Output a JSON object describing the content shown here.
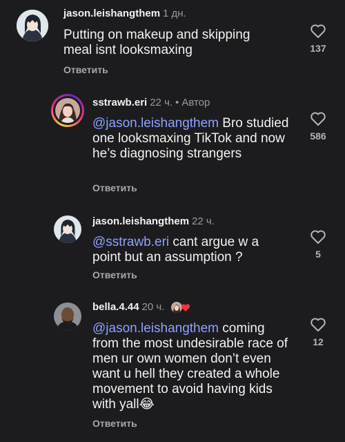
{
  "comments": [
    {
      "username": "jason.leishangthem",
      "time": "1 дн.",
      "text": "Putting on makeup and skipping meal isnt looksmaxing",
      "reply_label": "Ответить",
      "likes": "137"
    },
    {
      "username": "sstrawb.eri",
      "time": "22 ч.",
      "author_badge": "Автор",
      "mention": "@jason.leishangthem",
      "text": " Bro studied one looksmaxing TikTok and now he’s diagnosing strangers",
      "reply_label": "Ответить",
      "likes": "586"
    },
    {
      "username": "jason.leishangthem",
      "time": "22 ч.",
      "mention": "@sstrawb.eri",
      "text": " cant argue w a point but an assumption ?",
      "reply_label": "Ответить",
      "likes": "5"
    },
    {
      "username": "bella.4.44",
      "time": "20 ч.",
      "mention": "@jason.leishangthem",
      "text": " coming from the most undesirable race of men ur own women don’t even want u hell they created a whole movement to avoid having kids with yall😂",
      "reply_label": "Ответить",
      "likes": "12"
    }
  ],
  "icons": {
    "like": "heart-outline-icon",
    "reaction": "author-liked-heart-icon"
  },
  "colors": {
    "background": "#1c1c1e",
    "mention": "#8ea1ff",
    "secondary_text": "#9a9a9a",
    "liked_heart": "#ff3040"
  }
}
